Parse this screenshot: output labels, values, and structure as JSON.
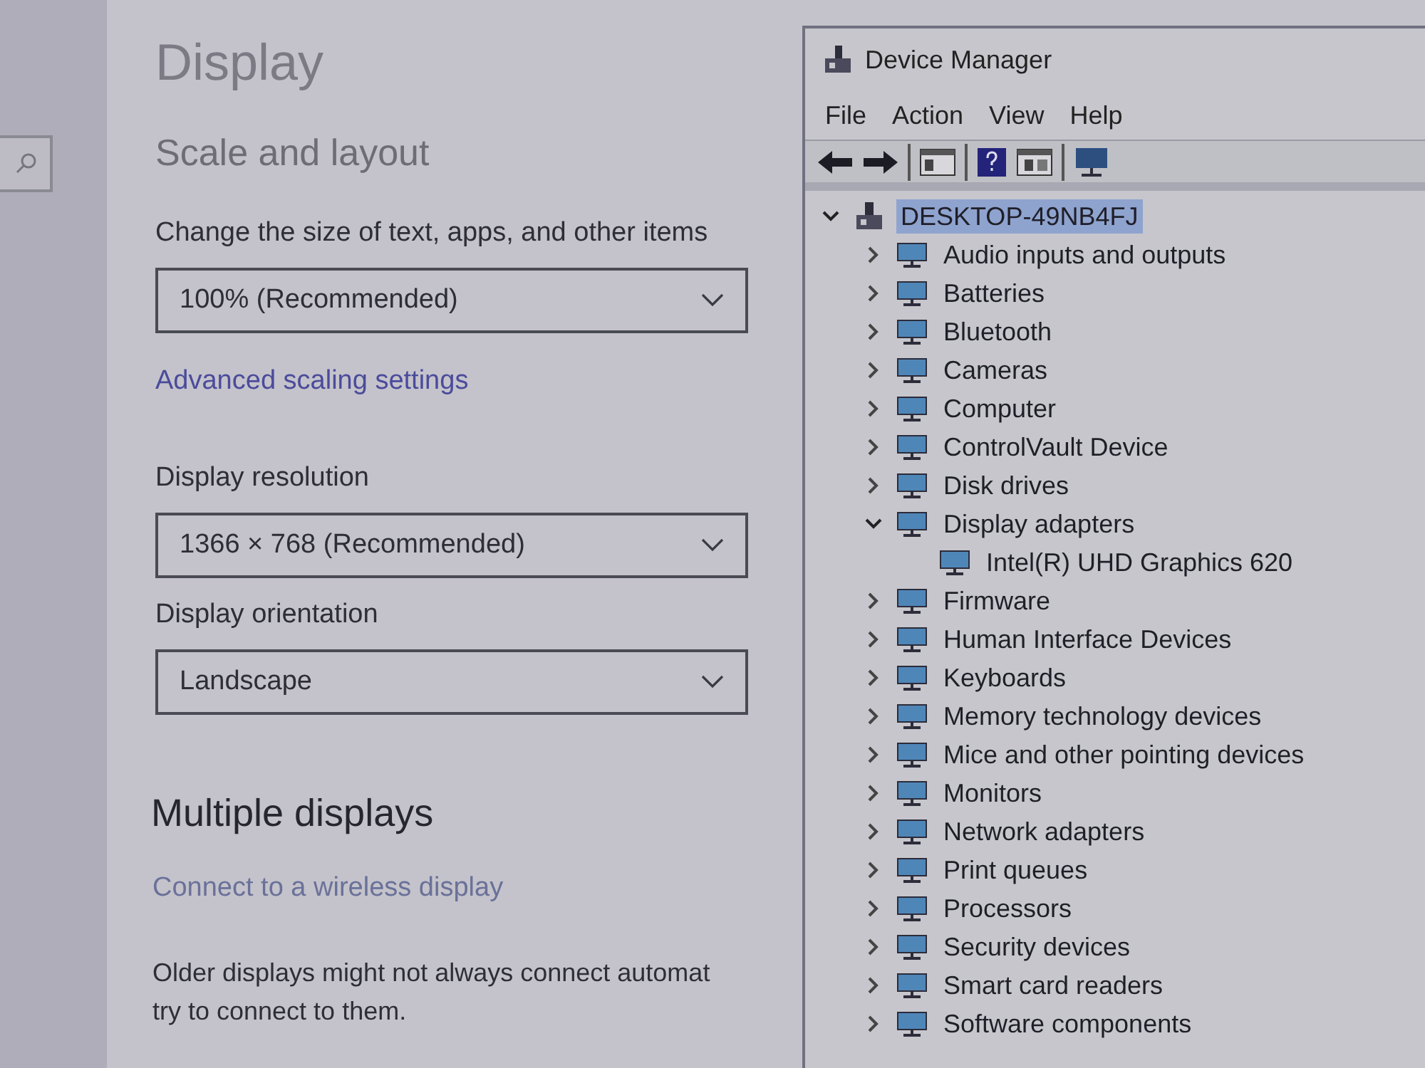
{
  "settings": {
    "title": "Display",
    "section": "Scale and layout",
    "dropdowns": [
      {
        "label": "Change the size of text, apps, and other items",
        "value": "100% (Recommended)"
      },
      {
        "label": "Display resolution",
        "value": "1366 × 768 (Recommended)"
      },
      {
        "label": "Display orientation",
        "value": "Landscape"
      }
    ],
    "scaling_link": "Advanced scaling settings",
    "multiple_heading": "Multiple displays",
    "wireless_link": "Connect to a wireless display",
    "paragraph_lines": [
      "Older displays might not always connect automat",
      "try to connect to them."
    ]
  },
  "device_manager": {
    "title": "Device Manager",
    "menu": [
      "File",
      "Action",
      "View",
      "Help"
    ],
    "tree": {
      "label": "DESKTOP-49NB4FJ",
      "expanded": true,
      "selected": true,
      "children": [
        {
          "label": "Audio inputs and outputs",
          "expanded": false
        },
        {
          "label": "Batteries",
          "expanded": false
        },
        {
          "label": "Bluetooth",
          "expanded": false
        },
        {
          "label": "Cameras",
          "expanded": false
        },
        {
          "label": "Computer",
          "expanded": false
        },
        {
          "label": "ControlVault Device",
          "expanded": false
        },
        {
          "label": "Disk drives",
          "expanded": false
        },
        {
          "label": "Display adapters",
          "expanded": true,
          "children": [
            {
              "label": "Intel(R) UHD Graphics 620"
            }
          ]
        },
        {
          "label": "Firmware",
          "expanded": false
        },
        {
          "label": "Human Interface Devices",
          "expanded": false
        },
        {
          "label": "Keyboards",
          "expanded": false
        },
        {
          "label": "Memory technology devices",
          "expanded": false
        },
        {
          "label": "Mice and other pointing devices",
          "expanded": false
        },
        {
          "label": "Monitors",
          "expanded": false
        },
        {
          "label": "Network adapters",
          "expanded": false
        },
        {
          "label": "Print queues",
          "expanded": false
        },
        {
          "label": "Processors",
          "expanded": false
        },
        {
          "label": "Security devices",
          "expanded": false
        },
        {
          "label": "Smart card readers",
          "expanded": false
        },
        {
          "label": "Software components",
          "expanded": false
        }
      ]
    }
  }
}
